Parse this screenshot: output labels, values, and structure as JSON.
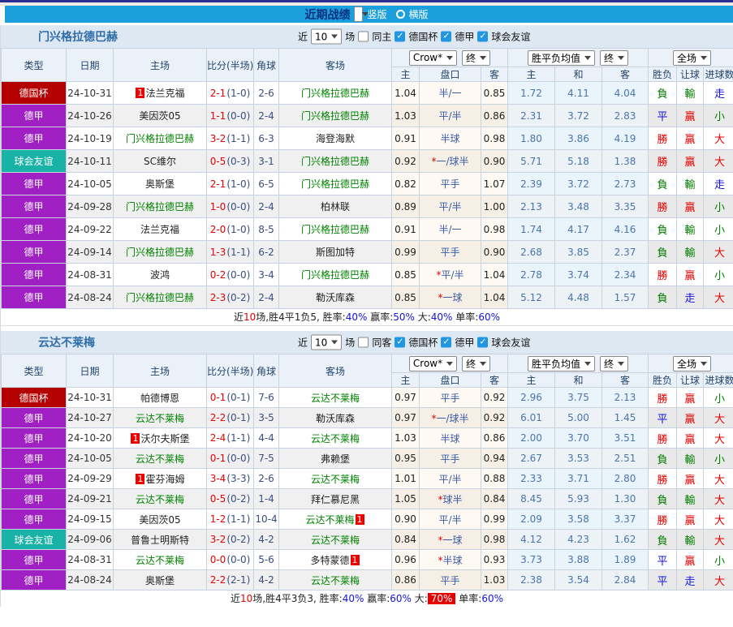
{
  "topbar": {
    "title": "近期战绩",
    "vertical_label": "竖版",
    "horizontal_label": "横版"
  },
  "table_headers": {
    "type": "类型",
    "date": "日期",
    "home": "主场",
    "score": "比分(半场)",
    "corner": "角球",
    "away": "客场",
    "odds_company": "Crow*",
    "final_a": "终",
    "avg": "胜平负均值",
    "final_b": "终",
    "scope": "全场",
    "sub_home": "主",
    "sub_handicap": "盘口",
    "sub_away": "客",
    "sub_home2": "主",
    "sub_draw": "和",
    "sub_away2": "客",
    "sub_wdl": "胜负",
    "sub_let": "让球",
    "sub_goals": "进球数"
  },
  "sections": [
    {
      "team": "门兴格拉德巴赫",
      "filters": {
        "near": "近",
        "count": "10",
        "games": "场",
        "same": "同主",
        "cup": "德国杯",
        "league": "德甲",
        "friendly": "球会友谊"
      },
      "rows": [
        {
          "lg": "德国杯",
          "date": "24-10-31",
          "home": "法兰克福",
          "hb": "1",
          "ft": "2-1",
          "ht": "(1-0)",
          "corner": "2-6",
          "away": "门兴格拉德巴赫",
          "ab": "",
          "oh": "1.04",
          "hc": "半/一",
          "oa": "0.85",
          "ah": "1.72",
          "ad": "4.11",
          "aa": "4.04",
          "r1": "負",
          "r2": "輸",
          "r3": "走"
        },
        {
          "lg": "德甲",
          "date": "24-10-26",
          "home": "美因茨05",
          "hb": "",
          "ft": "1-1",
          "ht": "(0-0)",
          "corner": "2-4",
          "away": "门兴格拉德巴赫",
          "ab": "",
          "oh": "1.03",
          "hc": "平/半",
          "oa": "0.86",
          "ah": "2.31",
          "ad": "3.72",
          "aa": "2.83",
          "r1": "平",
          "r2": "贏",
          "r3": "小"
        },
        {
          "lg": "德甲",
          "date": "24-10-19",
          "home": "门兴格拉德巴赫",
          "hb": "",
          "ft": "3-2",
          "ht": "(1-1)",
          "corner": "6-3",
          "away": "海登海默",
          "ab": "",
          "oh": "0.91",
          "hc": "半球",
          "oa": "0.98",
          "ah": "1.80",
          "ad": "3.86",
          "aa": "4.19",
          "r1": "勝",
          "r2": "贏",
          "r3": "大"
        },
        {
          "lg": "球会友谊",
          "date": "24-10-11",
          "home": "SC维尔",
          "hb": "",
          "ft": "0-5",
          "ht": "(0-3)",
          "corner": "3-1",
          "away": "门兴格拉德巴赫",
          "ab": "",
          "oh": "0.92",
          "hc": "*一/球半",
          "oa": "0.90",
          "ah": "5.71",
          "ad": "5.18",
          "aa": "1.38",
          "r1": "勝",
          "r2": "贏",
          "r3": "大"
        },
        {
          "lg": "德甲",
          "date": "24-10-05",
          "home": "奥斯堡",
          "hb": "",
          "ft": "2-1",
          "ht": "(1-0)",
          "corner": "6-5",
          "away": "门兴格拉德巴赫",
          "ab": "",
          "oh": "0.82",
          "hc": "平手",
          "oa": "1.07",
          "ah": "2.39",
          "ad": "3.72",
          "aa": "2.73",
          "r1": "負",
          "r2": "輸",
          "r3": "走"
        },
        {
          "lg": "德甲",
          "date": "24-09-28",
          "home": "门兴格拉德巴赫",
          "hb": "",
          "ft": "1-0",
          "ht": "(0-0)",
          "corner": "2-4",
          "away": "柏林联",
          "ab": "",
          "oh": "0.89",
          "hc": "平/半",
          "oa": "1.00",
          "ah": "2.13",
          "ad": "3.48",
          "aa": "3.35",
          "r1": "勝",
          "r2": "贏",
          "r3": "小"
        },
        {
          "lg": "德甲",
          "date": "24-09-22",
          "home": "法兰克福",
          "hb": "",
          "ft": "2-0",
          "ht": "(1-0)",
          "corner": "8-5",
          "away": "门兴格拉德巴赫",
          "ab": "",
          "oh": "0.91",
          "hc": "半/一",
          "oa": "0.98",
          "ah": "1.74",
          "ad": "4.17",
          "aa": "4.16",
          "r1": "負",
          "r2": "輸",
          "r3": "小"
        },
        {
          "lg": "德甲",
          "date": "24-09-14",
          "home": "门兴格拉德巴赫",
          "hb": "",
          "ft": "1-3",
          "ht": "(1-1)",
          "corner": "6-2",
          "away": "斯图加特",
          "ab": "",
          "oh": "0.99",
          "hc": "平手",
          "oa": "0.90",
          "ah": "2.68",
          "ad": "3.85",
          "aa": "2.37",
          "r1": "負",
          "r2": "輸",
          "r3": "大"
        },
        {
          "lg": "德甲",
          "date": "24-08-31",
          "home": "波鸿",
          "hb": "",
          "ft": "0-2",
          "ht": "(0-0)",
          "corner": "3-4",
          "away": "门兴格拉德巴赫",
          "ab": "",
          "oh": "0.85",
          "hc": "*平/半",
          "oa": "1.04",
          "ah": "2.78",
          "ad": "3.74",
          "aa": "2.34",
          "r1": "勝",
          "r2": "贏",
          "r3": "小"
        },
        {
          "lg": "德甲",
          "date": "24-08-24",
          "home": "门兴格拉德巴赫",
          "hb": "",
          "ft": "2-3",
          "ht": "(0-2)",
          "corner": "2-4",
          "away": "勒沃库森",
          "ab": "",
          "oh": "0.85",
          "hc": "*一球",
          "oa": "1.04",
          "ah": "5.12",
          "ad": "4.48",
          "aa": "1.57",
          "r1": "負",
          "r2": "走",
          "r3": "大"
        }
      ],
      "footer": {
        "near": "近",
        "count": "10",
        "record": "场,胜4平1负5, 胜率:",
        "rate1": "40%",
        "label2": "赢率:",
        "rate2": "50%",
        "label3": "大:",
        "rate3": "40%",
        "label4": "单率:",
        "rate4": "60%"
      }
    },
    {
      "team": "云达不莱梅",
      "filters": {
        "near": "近",
        "count": "10",
        "games": "场",
        "same": "同客",
        "cup": "德国杯",
        "league": "德甲",
        "friendly": "球会友谊"
      },
      "rows": [
        {
          "lg": "德国杯",
          "date": "24-10-31",
          "home": "帕德博恩",
          "hb": "",
          "ft": "0-1",
          "ht": "(0-1)",
          "corner": "7-6",
          "away": "云达不莱梅",
          "ab": "",
          "oh": "0.97",
          "hc": "平手",
          "oa": "0.92",
          "ah": "2.96",
          "ad": "3.75",
          "aa": "2.13",
          "r1": "勝",
          "r2": "贏",
          "r3": "小"
        },
        {
          "lg": "德甲",
          "date": "24-10-27",
          "home": "云达不莱梅",
          "hb": "",
          "ft": "2-2",
          "ht": "(0-1)",
          "corner": "3-5",
          "away": "勒沃库森",
          "ab": "",
          "oh": "0.97",
          "hc": "*一/球半",
          "oa": "0.92",
          "ah": "6.01",
          "ad": "5.00",
          "aa": "1.45",
          "r1": "平",
          "r2": "贏",
          "r3": "大"
        },
        {
          "lg": "德甲",
          "date": "24-10-20",
          "home": "沃尔夫斯堡",
          "hb": "1",
          "ft": "2-4",
          "ht": "(1-1)",
          "corner": "4-4",
          "away": "云达不莱梅",
          "ab": "",
          "oh": "1.03",
          "hc": "半球",
          "oa": "0.86",
          "ah": "2.00",
          "ad": "3.70",
          "aa": "3.51",
          "r1": "勝",
          "r2": "贏",
          "r3": "大"
        },
        {
          "lg": "德甲",
          "date": "24-10-05",
          "home": "云达不莱梅",
          "hb": "",
          "ft": "0-1",
          "ht": "(0-0)",
          "corner": "7-5",
          "away": "弗赖堡",
          "ab": "",
          "oh": "0.95",
          "hc": "平手",
          "oa": "0.94",
          "ah": "2.67",
          "ad": "3.53",
          "aa": "2.51",
          "r1": "負",
          "r2": "輸",
          "r3": "小"
        },
        {
          "lg": "德甲",
          "date": "24-09-29",
          "home": "霍芬海姆",
          "hb": "1",
          "ft": "3-4",
          "ht": "(3-3)",
          "corner": "2-6",
          "away": "云达不莱梅",
          "ab": "",
          "oh": "1.01",
          "hc": "平/半",
          "oa": "0.88",
          "ah": "2.33",
          "ad": "3.71",
          "aa": "2.80",
          "r1": "勝",
          "r2": "贏",
          "r3": "大"
        },
        {
          "lg": "德甲",
          "date": "24-09-21",
          "home": "云达不莱梅",
          "hb": "",
          "ft": "0-5",
          "ht": "(0-2)",
          "corner": "1-4",
          "away": "拜仁慕尼黑",
          "ab": "",
          "oh": "1.05",
          "hc": "*球半",
          "oa": "0.84",
          "ah": "8.45",
          "ad": "5.93",
          "aa": "1.30",
          "r1": "負",
          "r2": "輸",
          "r3": "大"
        },
        {
          "lg": "德甲",
          "date": "24-09-15",
          "home": "美因茨05",
          "hb": "",
          "ft": "1-2",
          "ht": "(1-1)",
          "corner": "10-4",
          "away": "云达不莱梅",
          "ab": "1",
          "oh": "0.90",
          "hc": "平/半",
          "oa": "0.99",
          "ah": "2.09",
          "ad": "3.58",
          "aa": "3.37",
          "r1": "勝",
          "r2": "贏",
          "r3": "大"
        },
        {
          "lg": "球会友谊",
          "date": "24-09-06",
          "home": "普鲁士明斯特",
          "hb": "",
          "ft": "3-2",
          "ht": "(0-2)",
          "corner": "4-2",
          "away": "云达不莱梅",
          "ab": "",
          "oh": "0.84",
          "hc": "*一球",
          "oa": "0.98",
          "ah": "4.12",
          "ad": "4.23",
          "aa": "1.62",
          "r1": "負",
          "r2": "輸",
          "r3": "大"
        },
        {
          "lg": "德甲",
          "date": "24-08-31",
          "home": "云达不莱梅",
          "hb": "",
          "ft": "0-0",
          "ht": "(0-0)",
          "corner": "5-6",
          "away": "多特蒙德",
          "ab": "1",
          "oh": "0.96",
          "hc": "*半球",
          "oa": "0.93",
          "ah": "3.73",
          "ad": "3.88",
          "aa": "1.89",
          "r1": "平",
          "r2": "贏",
          "r3": "小"
        },
        {
          "lg": "德甲",
          "date": "24-08-24",
          "home": "奥斯堡",
          "hb": "",
          "ft": "2-2",
          "ht": "(2-1)",
          "corner": "4-2",
          "away": "云达不莱梅",
          "ab": "",
          "oh": "0.86",
          "hc": "平手",
          "oa": "1.03",
          "ah": "2.38",
          "ad": "3.54",
          "aa": "2.84",
          "r1": "平",
          "r2": "走",
          "r3": "大"
        }
      ],
      "footer": {
        "near": "近",
        "count": "10",
        "record": "场,胜4平3负3, 胜率:",
        "rate1": "40%",
        "label2": "赢率:",
        "rate2": "60%",
        "label3": "大:",
        "rate3": "70%",
        "label4": "单率:",
        "rate4": "60%"
      }
    }
  ]
}
